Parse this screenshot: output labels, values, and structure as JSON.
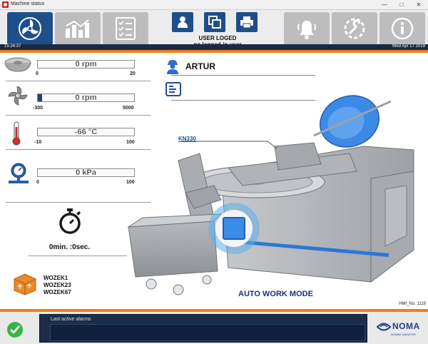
{
  "window": {
    "title": "Machine status"
  },
  "header": {
    "user_status_line1": "USER LOGED",
    "user_status_line2": "no logged-in user",
    "time": "15:24:37",
    "date": "Wed Apr 17 2019"
  },
  "gauges": [
    {
      "name": "bowl-speed",
      "icon": "bowl-icon",
      "value": "0 rpm",
      "min": "0",
      "max": "20",
      "fill_fraction": 0
    },
    {
      "name": "knife-speed",
      "icon": "knife-icon",
      "value": "0 rpm",
      "min": "-300",
      "max": "5000",
      "fill_fraction": 0.045
    },
    {
      "name": "temperature",
      "icon": "thermometer-icon",
      "value": "-66 °C",
      "min": "-10",
      "max": "100",
      "fill_fraction": 0
    },
    {
      "name": "pressure",
      "icon": "pressure-gauge-icon",
      "value": "0 kPa",
      "min": "0",
      "max": "100",
      "fill_fraction": 0
    }
  ],
  "timer": {
    "text": "0min. :0sec."
  },
  "wozki": {
    "line1": "WOZEK1",
    "line2": "WOZEK23",
    "line3": "WOZEK67"
  },
  "user": {
    "name": "ARTUR"
  },
  "machine": {
    "model": "KN330",
    "mode": "AUTO WORK MODE"
  },
  "hmi": {
    "label": "HMI_No. 1119"
  },
  "alarms": {
    "title": "Last active alarms"
  },
  "logo": {
    "text": "NOMA",
    "subtext": "NOWAK MASZYNY"
  },
  "colors": {
    "accent_orange": "#f07d19",
    "brand_blue": "#1f4f8a",
    "ok_green": "#39b44a"
  }
}
